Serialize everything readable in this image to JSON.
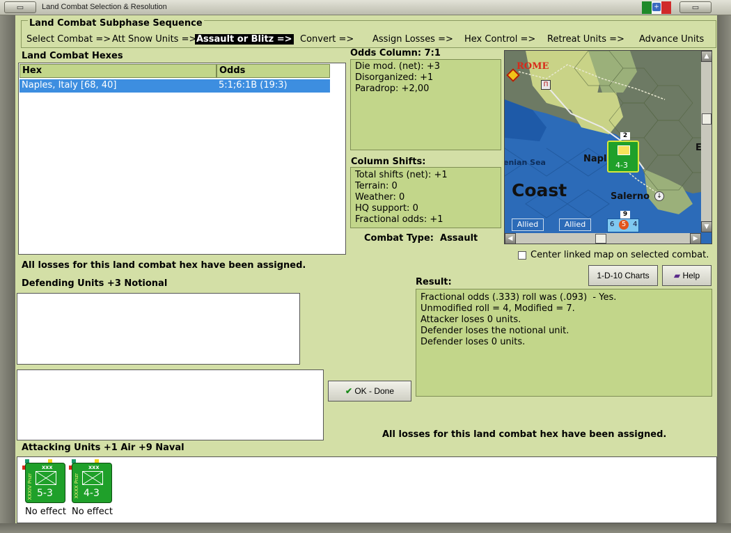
{
  "window": {
    "title": "Land Combat Selection & Resolution"
  },
  "sequence": {
    "title": "Land Combat Subphase Sequence",
    "steps": [
      "Select Combat =>",
      "Att Snow Units =>",
      "Assault or Blitz =>",
      "Convert =>",
      "Assign Losses =>",
      "Hex Control =>",
      "Retreat Units =>",
      "Advance Units"
    ],
    "active_step": "Assault or Blitz =>"
  },
  "hexes": {
    "title": "Land Combat Hexes",
    "columns": [
      "Hex",
      "Odds"
    ],
    "rows": [
      {
        "hex": "Naples, Italy [68, 40]",
        "odds": "5:1;6:1B (19:3)"
      }
    ]
  },
  "odds": {
    "title": "Odds Column: 7:1",
    "lines": [
      "Die mod. (net): +3",
      "Disorganized: +1",
      "Paradrop: +2,00"
    ]
  },
  "shifts": {
    "title": "Column Shifts:",
    "lines": [
      "Total shifts (net): +1",
      "Terrain: 0",
      "Weather: 0",
      "HQ support: 0",
      "Fractional odds: +1"
    ]
  },
  "combat_type": "Combat Type:  Assault",
  "map": {
    "labels": {
      "rome": "ROME",
      "sea": "enian Sea",
      "naples": "Napl",
      "coast": "Coast",
      "salerno": "Salerno",
      "edge": "E"
    },
    "tabs": [
      "Allied",
      "Allied"
    ],
    "stack_counts": [
      "2",
      "9"
    ],
    "stack_values": [
      "6",
      "5",
      "4"
    ],
    "counter_value": "4-3",
    "center_checkbox_label": "Center linked map on selected combat.",
    "center_checked": false
  },
  "losses_msg_top": "All losses for this land combat hex have been assigned.",
  "defending": {
    "title": "Defending Units +3 Notional"
  },
  "buttons": {
    "charts": "1-D-10 Charts",
    "help": "Help",
    "ok": "OK - Done"
  },
  "result": {
    "title": "Result:",
    "lines": [
      "Fractional odds (.333) roll was (.093)  - Yes.",
      "Unmodified roll = 4, Modified = 7.",
      "Attacker loses 0 units.",
      "Defender loses the notional unit.",
      "Defender loses 0 units."
    ]
  },
  "losses_msg_bottom": "All losses for this land combat hex have been assigned.",
  "attacking": {
    "title": "Attacking Units +1 Air +9 Naval",
    "units": [
      {
        "corps": "XXXIV Pnzr",
        "size": "xxx",
        "value": "5-3",
        "result": "No effect"
      },
      {
        "corps": "XXXX Pnzr",
        "size": "xxx",
        "value": "4-3",
        "result": "No effect"
      }
    ]
  },
  "colors": {
    "panel": "#d3dfa6",
    "panel_dark": "#c2d68a",
    "selection": "#3d8ee0",
    "counter": "#1fa02a",
    "sea": "#2c6bb8"
  }
}
